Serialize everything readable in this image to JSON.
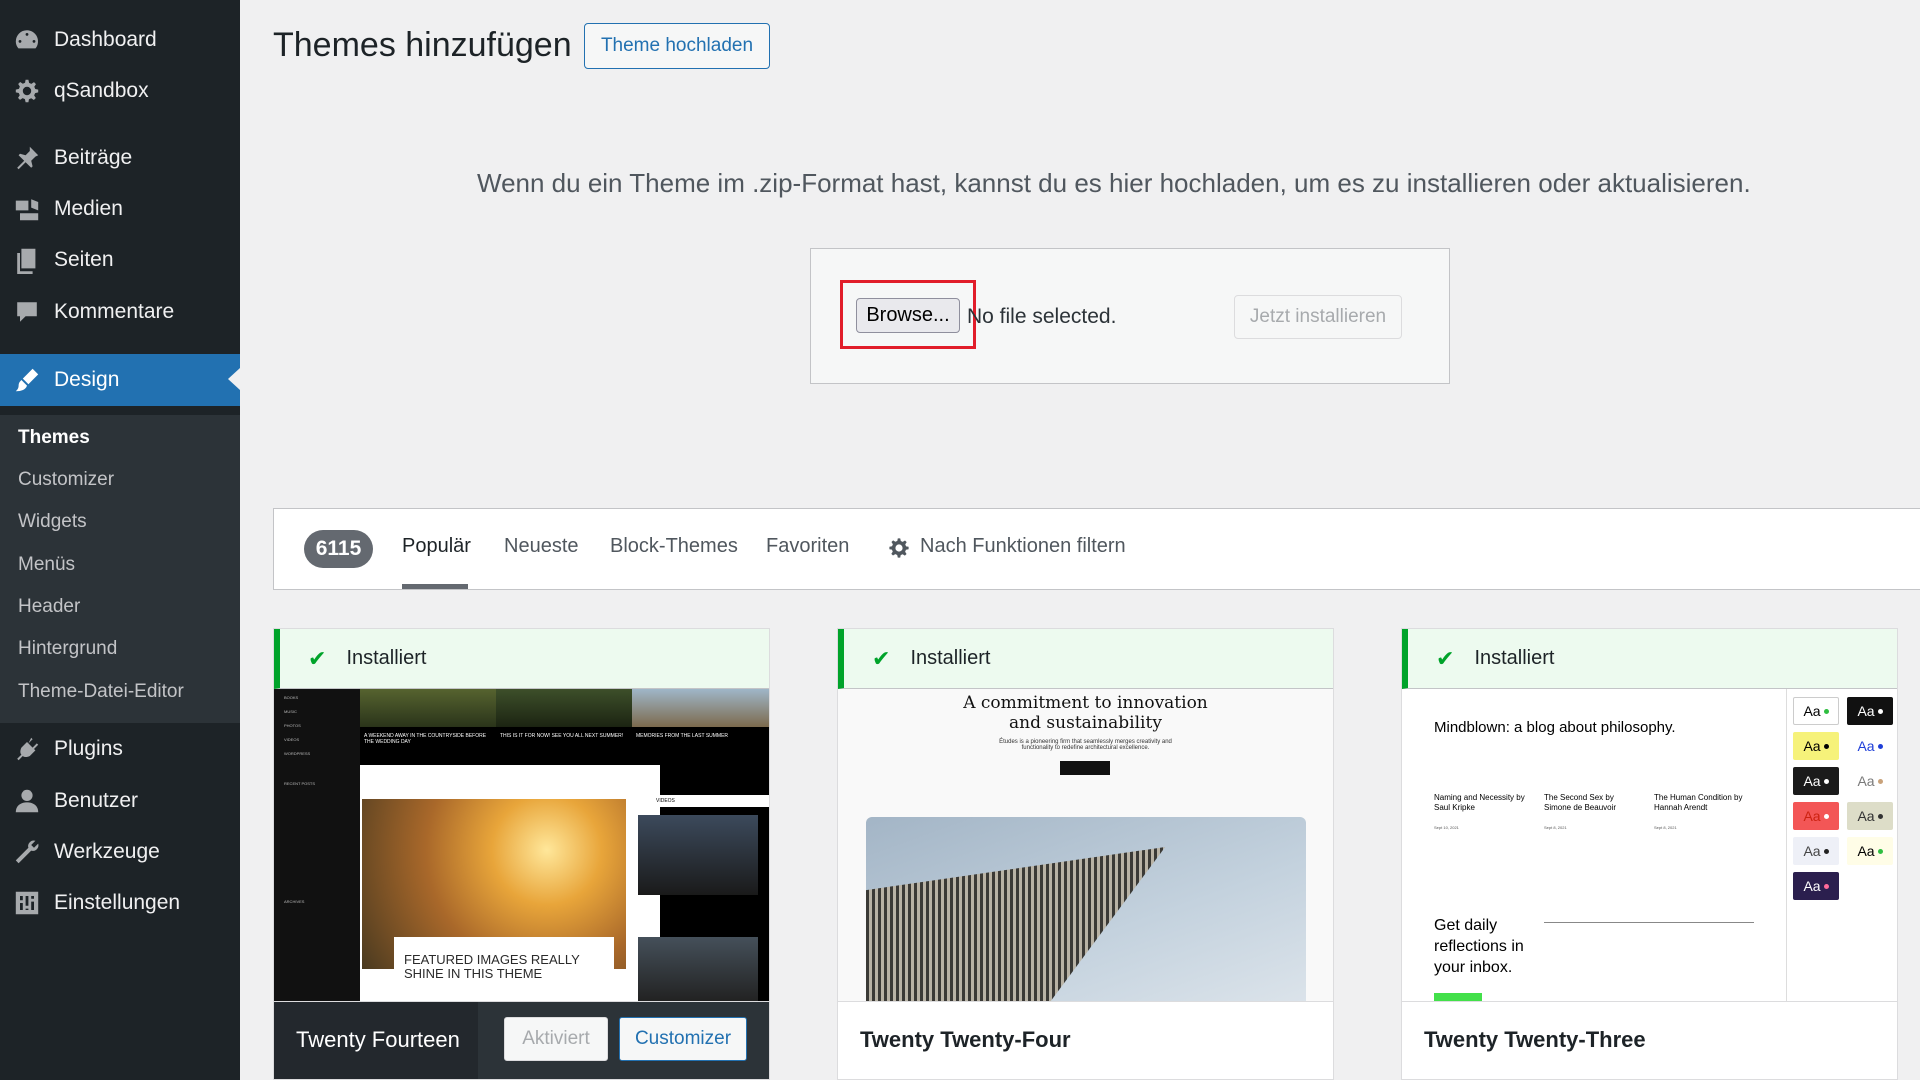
{
  "sidebar": {
    "menu": [
      {
        "label": "Dashboard",
        "icon": "dashboard-icon"
      },
      {
        "label": "qSandbox",
        "icon": "gear-icon"
      },
      {
        "label": "Beiträge",
        "icon": "pin-icon"
      },
      {
        "label": "Medien",
        "icon": "media-icon"
      },
      {
        "label": "Seiten",
        "icon": "pages-icon"
      },
      {
        "label": "Kommentare",
        "icon": "comment-icon"
      },
      {
        "label": "Design",
        "icon": "brush-icon"
      },
      {
        "label": "Plugins",
        "icon": "plugin-icon"
      },
      {
        "label": "Benutzer",
        "icon": "user-icon"
      },
      {
        "label": "Werkzeuge",
        "icon": "wrench-icon"
      },
      {
        "label": "Einstellungen",
        "icon": "settings-icon"
      }
    ],
    "submenu": [
      "Themes",
      "Customizer",
      "Widgets",
      "Menüs",
      "Header",
      "Hintergrund",
      "Theme-Datei-Editor"
    ]
  },
  "header": {
    "title": "Themes hinzufügen",
    "upload_button": "Theme hochladen"
  },
  "upload": {
    "hint": "Wenn du ein Theme im .zip-Format hast, kannst du es hier hochladen, um es zu installieren oder aktualisieren.",
    "browse_label": "Browse...",
    "file_status": "No file selected.",
    "install_label": "Jetzt installieren"
  },
  "filter": {
    "count": "6115",
    "tabs": [
      "Populär",
      "Neueste",
      "Block-Themes",
      "Favoriten"
    ],
    "feature_filter": "Nach Funktionen filtern"
  },
  "themes": [
    {
      "installed": "Installiert",
      "name": "Twenty Fourteen",
      "activated_label": "Aktiviert",
      "customizer_label": "Customizer",
      "preview": {
        "side_links": [
          "BOOKS",
          "MUSIC",
          "PHOTOS",
          "VIDEOS",
          "WORDPRESS",
          "RECENT POSTS",
          "ARCHIVES"
        ],
        "headlines": [
          "A WEEKEND AWAY IN THE COUNTRYSIDE BEFORE THE WEDDING DAY",
          "THIS IS IT FOR NOW! SEE YOU ALL NEXT SUMMER!",
          "MEMORIES FROM THE LAST SUMMER"
        ],
        "caption": "FEATURED IMAGES REALLY SHINE IN THIS THEME",
        "videos_label": "VIDEOS"
      }
    },
    {
      "installed": "Installiert",
      "name": "Twenty Twenty-Four",
      "preview": {
        "title": "A commitment to innovation and sustainability",
        "subtitle": "Études is a pioneering firm that seamlessly merges creativity and functionality to redefine architectural excellence."
      }
    },
    {
      "installed": "Installiert",
      "name": "Twenty Twenty-Three",
      "preview": {
        "blog_title": "Mindblown: a blog about philosophy.",
        "posts": [
          {
            "title": "Naming and Necessity by Saul Kripke",
            "date": "Sept 10, 2021"
          },
          {
            "title": "The Second Sex by Simone de Beauvoir",
            "date": "Sept 8, 2021"
          },
          {
            "title": "The Human Condition by Hannah Arendt",
            "date": "Sept 8, 2021"
          }
        ],
        "newsletter": "Get daily reflections in your inbox.",
        "swatch_label": "Aa"
      }
    }
  ],
  "colors": {
    "sidebar_bg": "#1d2327",
    "accent": "#2271b1",
    "installed_green": "#00a32a",
    "highlight_red": "#e11d2a"
  }
}
